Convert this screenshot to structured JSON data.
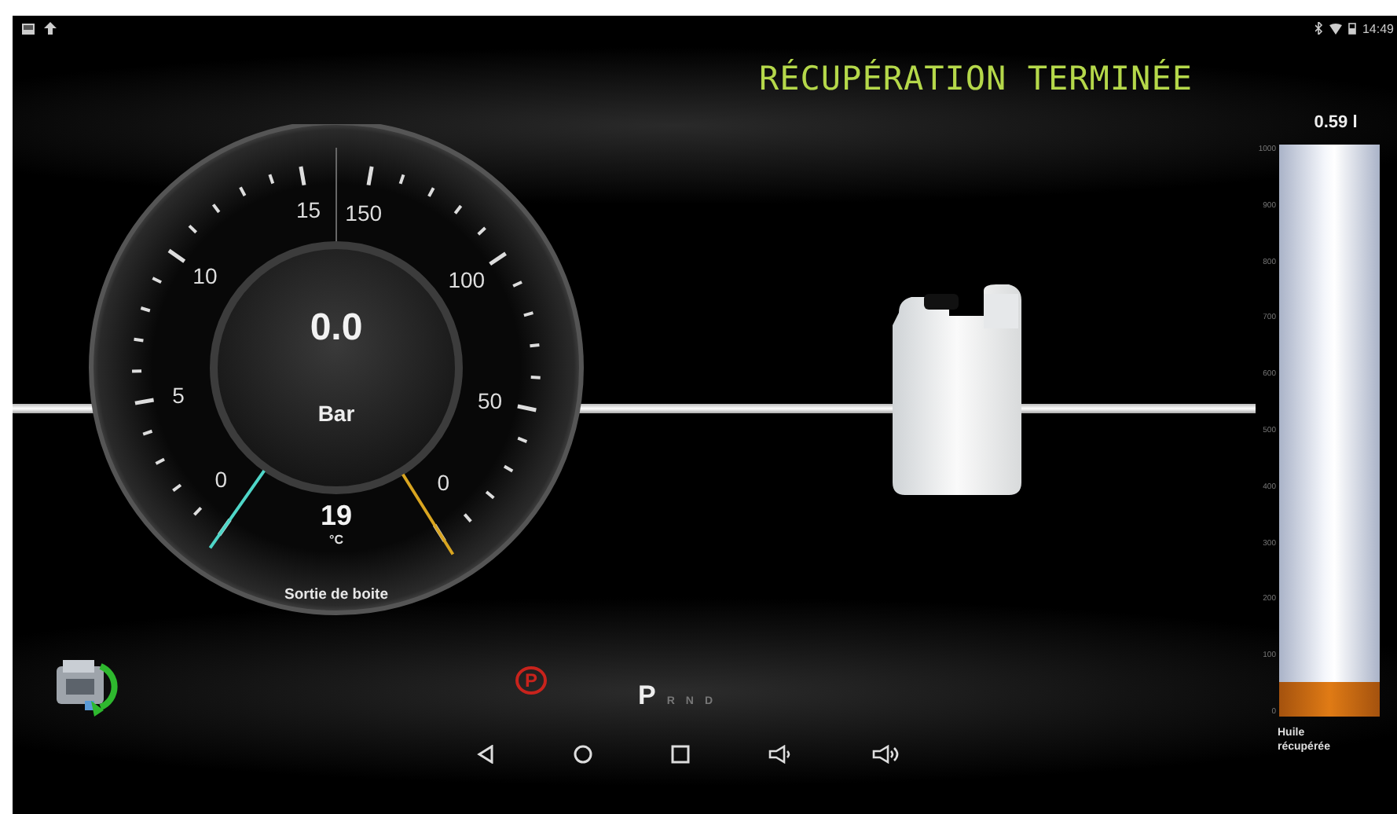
{
  "status_bar": {
    "time": "14:49"
  },
  "title": "RÉCUPÉRATION TERMINÉE",
  "gauge": {
    "value": "0.0",
    "unit": "Bar",
    "temperature": "19",
    "temperature_unit": "°C",
    "caption": "Sortie de boite",
    "left_scale": {
      "labels": [
        "0",
        "5",
        "10",
        "15"
      ]
    },
    "right_scale": {
      "labels": [
        "0",
        "50",
        "100",
        "150"
      ]
    }
  },
  "container": {
    "reading": "0.59 l",
    "level": 0.06,
    "scale": [
      "1000",
      "900",
      "800",
      "700",
      "600",
      "500",
      "400",
      "300",
      "200",
      "100",
      "0"
    ],
    "label": "Huile récupérée"
  },
  "parking_brake": {
    "symbol": "P",
    "on": true
  },
  "gears": [
    {
      "label": "P",
      "selected": true
    },
    {
      "label": "R",
      "selected": false
    },
    {
      "label": "N",
      "selected": false
    },
    {
      "label": "D",
      "selected": false
    }
  ]
}
